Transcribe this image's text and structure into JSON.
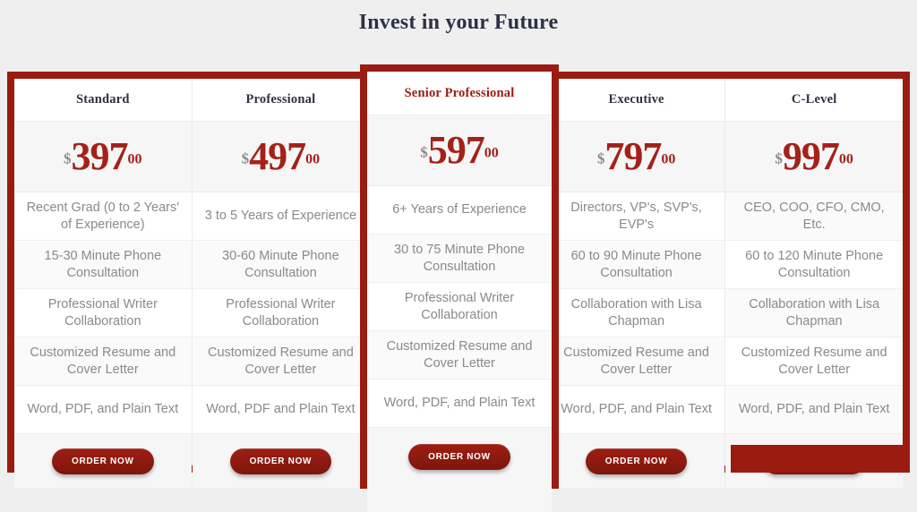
{
  "page": {
    "title": "Invest in your Future",
    "background_color": "#efefef",
    "accent_color": "#9b1b11",
    "price_color": "#a4211a",
    "feature_text_color": "#8a8a8a"
  },
  "cta": {
    "label": "ORDER NOW"
  },
  "currency_symbol": "$",
  "cents": "00",
  "plans": [
    {
      "name": "Standard",
      "price": "397",
      "featured": false,
      "features": [
        "Recent Grad (0 to 2 Years' of Experience)",
        "15-30 Minute Phone Consultation",
        "Professional Writer Collaboration",
        "Customized Resume and Cover Letter",
        "Word, PDF, and Plain Text"
      ]
    },
    {
      "name": "Professional",
      "price": "497",
      "featured": false,
      "features": [
        "3 to 5 Years of Experience",
        "30-60 Minute Phone Consultation",
        "Professional Writer Collaboration",
        "Customized Resume and Cover Letter",
        "Word, PDF and Plain Text"
      ]
    },
    {
      "name": "Senior Professional",
      "price": "597",
      "featured": true,
      "features": [
        "6+ Years of Experience",
        "30 to 75 Minute Phone Consultation",
        "Professional Writer Collaboration",
        "Customized Resume and Cover Letter",
        "Word, PDF, and Plain Text"
      ]
    },
    {
      "name": "Executive",
      "price": "797",
      "featured": false,
      "features": [
        "Directors, VP's, SVP's, EVP's",
        "60 to 90 Minute Phone Consultation",
        "Collaboration with Lisa Chapman",
        "Customized Resume and Cover Letter",
        "Word, PDF, and Plain Text"
      ]
    },
    {
      "name": "C-Level",
      "price": "997",
      "featured": false,
      "features": [
        "CEO, COO, CFO, CMO, Etc.",
        "60 to 120 Minute Phone Consultation",
        "Collaboration with Lisa Chapman",
        "Customized Resume and Cover Letter",
        "Word, PDF, and Plain Text"
      ]
    }
  ]
}
